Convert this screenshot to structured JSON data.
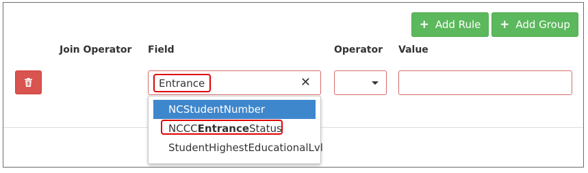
{
  "toolbar": {
    "add_rule_label": "Add Rule",
    "add_group_label": "Add Group",
    "plus_glyph": "+"
  },
  "headers": {
    "join_operator": "Join Operator",
    "field": "Field",
    "operator": "Operator",
    "value": "Value"
  },
  "rule": {
    "field_query": "Entrance",
    "clear_glyph": "✕",
    "operator_value": "",
    "value_text": ""
  },
  "dropdown": {
    "items": [
      {
        "label": "NCStudentNumber",
        "highlighted": true
      },
      {
        "label_pre": "NCCC",
        "label_match": "Entrance",
        "label_post": "Status",
        "highlighted": false
      },
      {
        "label": "StudentHighestEducationalLvl",
        "highlighted": false
      }
    ]
  },
  "colors": {
    "success": "#5cb85c",
    "danger": "#d9534f",
    "selected": "#3f87cc",
    "invalid_border": "#d56a6a",
    "annotation_red": "#e00000"
  },
  "icons": {
    "plus": "plus-icon",
    "trash": "trash-icon",
    "clear": "close-icon",
    "caret": "caret-down-icon"
  }
}
